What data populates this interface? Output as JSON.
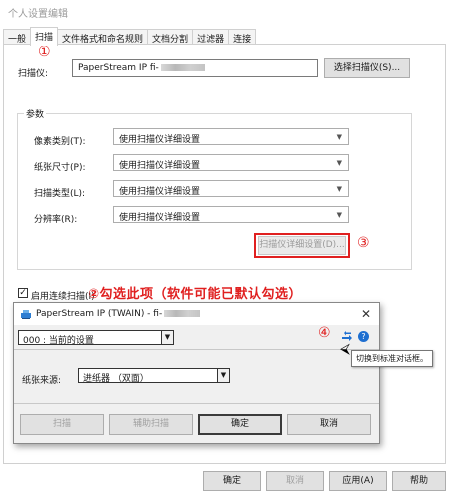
{
  "window": {
    "title": "个人设置编辑"
  },
  "tabs": [
    {
      "label": "一般"
    },
    {
      "label": "扫描"
    },
    {
      "label": "文件格式和命名规则"
    },
    {
      "label": "文档分割"
    },
    {
      "label": "过滤器"
    },
    {
      "label": "连接"
    }
  ],
  "scanner": {
    "label": "扫描仪:",
    "value": "PaperStream IP fi-",
    "select_button": "选择扫描仪(S)..."
  },
  "params": {
    "group_title": "参数",
    "rows": [
      {
        "label": "像素类别(T):",
        "value": "使用扫描仪详细设置"
      },
      {
        "label": "纸张尺寸(P):",
        "value": "使用扫描仪详细设置"
      },
      {
        "label": "扫描类型(L):",
        "value": "使用扫描仪详细设置"
      },
      {
        "label": "分辨率(R):",
        "value": "使用扫描仪详细设置"
      }
    ],
    "detail_button": "扫描仪详细设置(D)..."
  },
  "continuous": {
    "checkbox_label": "启用连续扫描(I)",
    "checked": true
  },
  "annotations": {
    "a1": "①",
    "a2": "②勾选此项（软件可能已默认勾选）",
    "a3": "③",
    "a4": "④"
  },
  "popup": {
    "title": "PaperStream IP (TWAIN) - fi-",
    "profile_value": "000 : 当前的设置",
    "paper_source_label": "纸张来源:",
    "paper_source_value": "进纸器 （双面）",
    "tooltip": "切换到标准对话框。",
    "buttons": {
      "scan": "扫描",
      "assist_scan": "辅助扫描",
      "ok": "确定",
      "cancel": "取消"
    }
  },
  "footer": {
    "ok": "确定",
    "cancel": "取消",
    "apply": "应用(A)",
    "help": "帮助"
  },
  "colors": {
    "annotation_red": "#e02020",
    "accent_blue": "#1e6fd0"
  }
}
